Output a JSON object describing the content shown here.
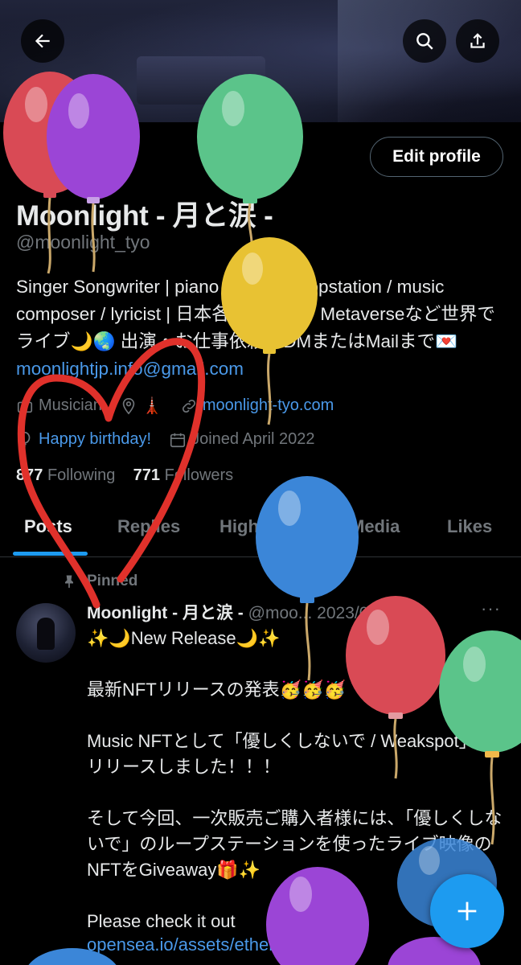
{
  "header": {
    "back_icon": "arrow-left-icon",
    "search_icon": "search-icon",
    "share_icon": "share-icon"
  },
  "profile": {
    "edit_label": "Edit profile",
    "display_name": "Moonlight - 月と涙 -",
    "handle": "@moonlight_tyo",
    "bio_text": "Singer Songwriter | piano / guitar / loopstation / music composer / lyricist | 日本各地、台湾、Metaverseなど世界でライブ🌙🌏 出演・お仕事依頼はDMまたはMailまで💌 ",
    "bio_email": "moonlightjp.info@gmail.com",
    "category": "Musician",
    "location_emoji": "🗼",
    "website": "moonlight-tyo.com",
    "birthday": "Happy birthday!",
    "joined": "Joined April 2022",
    "following_count": "877",
    "following_label": "Following",
    "followers_count": "771",
    "followers_label": "Followers"
  },
  "tabs": [
    {
      "label": "Posts"
    },
    {
      "label": "Replies"
    },
    {
      "label": "Highlights"
    },
    {
      "label": "Media"
    },
    {
      "label": "Likes"
    }
  ],
  "pinned_post": {
    "pinned_label": "Pinned",
    "author_name": "Moonlight - 月と涙 -",
    "author_handle": "@moo...",
    "date": "2023/08/15",
    "more_label": "···",
    "body": "✨🌙New Release🌙✨\n\n最新NFTリリースの発表🥳🥳🥳\n\nMusic NFTとして「優しくしないで / Weakspot」をリリースしました！！！\n\nそして今回、一次販売ご購入者様には、「優しくしないで」のループステーションを使ったライブ映像のNFTをGiveaway🎁✨\n\nPlease check it out",
    "link": "opensea.io/assets/ethereu..."
  },
  "compose_icon": "plus-icon",
  "colors": {
    "accent": "#1d9bf0",
    "link": "#4a99e9",
    "muted": "#71767b",
    "heart": "#e0312b"
  }
}
